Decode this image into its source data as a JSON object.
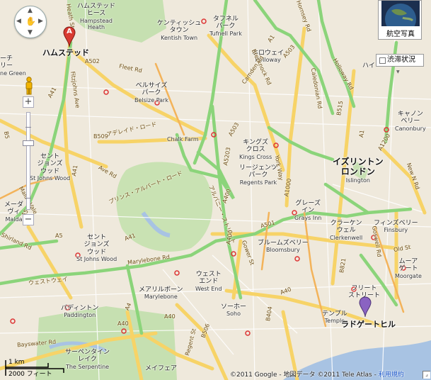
{
  "controls": {
    "satellite_label": "航空写真",
    "traffic_label": "渋滞状況"
  },
  "scale": {
    "km": "1 km",
    "ft": "2000 フィート"
  },
  "copyright": {
    "text": "©2011 Google - 地図データ ©2011 Tele Atlas - ",
    "link": "利用規約"
  },
  "markers": [
    {
      "letter": "A",
      "label": "ハムステッド",
      "color": "#d83a31"
    },
    {
      "letter": "",
      "label": "ラドゲートヒル",
      "color": "#8a63c2"
    }
  ],
  "areas": {
    "hampstead_heath": {
      "jp": "ハムステッド\nヒース",
      "en": "Hampstead\nHeath"
    },
    "kentish_town": {
      "jp": "ケンティッシュ\nタウン",
      "en": "Kentish Town"
    },
    "tufnell_park": {
      "jp": "タフネル\nパーク",
      "en": "Tufnell Park"
    },
    "holloway": {
      "jp": "ホロウェイ",
      "en": "Holloway"
    },
    "highbury": {
      "jp": "ハイ",
      "en": ""
    },
    "belsize_park": {
      "jp": "ベルサイズ\nパーク",
      "en": "Belsize Park"
    },
    "canonbury": {
      "jp": "キャノン\nベリー",
      "en": "Canonbury"
    },
    "kings_cross": {
      "jp": "キングズ\nクロス",
      "en": "Kings Cross"
    },
    "regents_park": {
      "jp": "リージェンツ\nパーク",
      "en": "Regents Park"
    },
    "islington": {
      "jp": "イズリントン\nロンドン",
      "en": "Islington"
    },
    "st_johns_wood_n": {
      "jp": "セント\nジョンズ\nウッド",
      "en": "St Johns Wood"
    },
    "greens_inn": {
      "jp": "グレーズ\nイン",
      "en": "Grays Inn"
    },
    "clerkenwell": {
      "jp": "クラーケン\nウェル",
      "en": "Clerkenwell"
    },
    "finsbury": {
      "jp": "フィンズベリー",
      "en": "Finsbury"
    },
    "st_johns_wood_s": {
      "jp": "セント\nジョンズ\nウッド",
      "en": "St Johns Wood"
    },
    "bloomsbury": {
      "jp": "ブルームズベリー",
      "en": "Bloomsbury"
    },
    "moorgate": {
      "jp": "ムーア\nゲート",
      "en": "Moorgate"
    },
    "maida": {
      "jp": "メーダ\nヴィ",
      "en": "Maida"
    },
    "west_end": {
      "jp": "ウェスト\nエンド",
      "en": "West End"
    },
    "marylebone": {
      "jp": "メアリルボーン",
      "en": "Marylebone"
    },
    "fleet_street": {
      "jp": "フリート\nストリート",
      "en": ""
    },
    "paddington": {
      "jp": "パディントン",
      "en": "Paddington"
    },
    "soho": {
      "jp": "ソーホー",
      "en": "Soho"
    },
    "temple": {
      "jp": "テンプル",
      "en": "Temple"
    },
    "serpentine": {
      "jp": "サーペンタイン\nレイク",
      "en": "The Serpentine"
    },
    "mayfair": {
      "jp": "メイフェア",
      "en": "Mayfair"
    },
    "arch_lf": {
      "jp": "ーチ\nリー",
      "en": "ne Green"
    }
  },
  "roads": {
    "adelaide": "アデレイド・ロード",
    "albert": "プリンス・アルバート・ロード",
    "albany": "アルバニー・ストリート",
    "westway": "ウェストウェイ",
    "chalk_farm": "Chalk Farm",
    "a502": "A502",
    "a41a": "A41",
    "a41b": "A41",
    "a41c": "A41",
    "a5a": "A5",
    "a5b": "A5",
    "a503": "A503",
    "a503b": "A503",
    "a1": "A1",
    "a1b": "A1",
    "a1200": "A1200",
    "a1000": "A1000",
    "a501": "A501",
    "a400": "A400",
    "a400b": "A400",
    "a40a": "A40",
    "a40b": "A40",
    "a40c": "A40",
    "a4": "A4",
    "b509": "B509",
    "b515": "B515",
    "b821": "B821",
    "b506": "B506",
    "b404": "B404",
    "a5203": "A5203",
    "fleet_rd": "Fleet Rd",
    "fitzjohns": "Fitzjohns Ave",
    "ave_rd": "Ave Rd",
    "maida_vale": "Maida Vale",
    "camden_rd": "Camden Rd",
    "holloway_rd": "Holloway Rd",
    "york_way": "York Way",
    "hornsey": "Hornsey Rd",
    "caledonian": "Caledonian Rd",
    "new_n_rd": "New N Rd",
    "goswell": "Goswell Rd",
    "old_st": "Old St",
    "gower": "Gower St",
    "marylebone_rd": "Marylebone Rd",
    "regent": "Regent St",
    "bayswater": "Bayswater Rd",
    "shirland": "Shirland Rd",
    "heath": "Heath St",
    "b5": "B5",
    "brecknock": "Brecknock Rd"
  },
  "colors": {
    "background": "#efe9dc",
    "main_road": "#f7d367",
    "major_road": "#8bd47a",
    "park": "#c6e0b1",
    "water": "#a8c3e3"
  }
}
